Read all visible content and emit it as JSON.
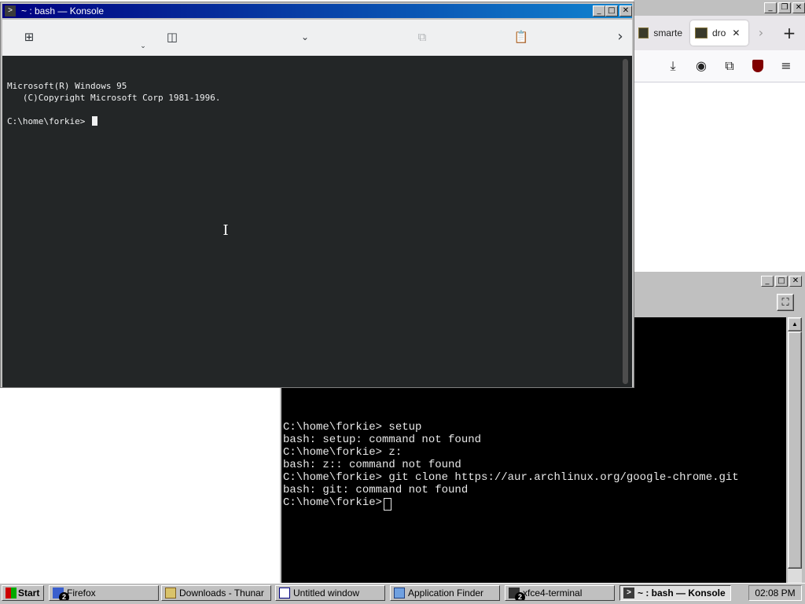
{
  "firefox": {
    "tabs": [
      {
        "label": "smarte"
      },
      {
        "label": "dro"
      }
    ],
    "icons": [
      "download-icon",
      "account-icon",
      "extensions-icon",
      "ublock-icon",
      "menu-icon"
    ]
  },
  "xfce_terminal": {
    "lines": [
      "C:\\home\\forkie> setup",
      "bash: setup: command not found",
      "C:\\home\\forkie> z:",
      "bash: z:: command not found",
      "C:\\home\\forkie> git clone https://aur.archlinux.org/google-chrome.git",
      "bash: git: command not found",
      "C:\\home\\forkie> "
    ]
  },
  "konsole": {
    "title": "~ : bash — Konsole",
    "lines": [
      "Microsoft(R) Windows 95",
      "   (C)Copyright Microsoft Corp 1981-1996.",
      "",
      "C:\\home\\forkie> "
    ]
  },
  "taskbar": {
    "start_label": "Start",
    "items": [
      {
        "label": "Firefox",
        "badge": "2"
      },
      {
        "label": "Downloads - Thunar"
      },
      {
        "label": "Untitled window"
      },
      {
        "label": "Application Finder"
      },
      {
        "label": "xfce4-terminal",
        "badge": "2"
      },
      {
        "label": "~ : bash — Konsole"
      }
    ],
    "clock": "02:08 PM"
  }
}
